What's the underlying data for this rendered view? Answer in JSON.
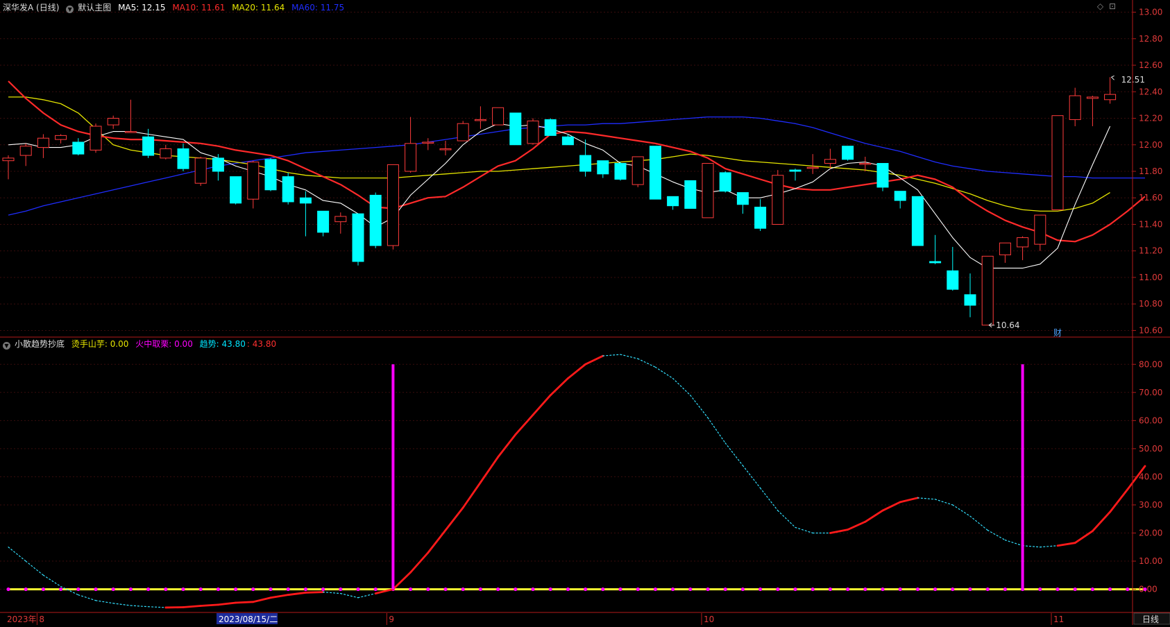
{
  "header": {
    "stock": "深华发A (日线)",
    "template": "默认主图",
    "ma5": "MA5: 12.15",
    "ma10": "MA10: 11.61",
    "ma20": "MA20: 11.64",
    "ma60": "MA60: 11.75"
  },
  "sub_header": {
    "name": "小散趋势抄底",
    "s1": "烫手山芋: 0.00",
    "s2": "火中取栗: 0.00",
    "s3": "趋势: 43.80",
    "s4": ": 43.80"
  },
  "bottom": {
    "year": "2023年",
    "months": [
      "8",
      "9",
      "10",
      "11"
    ],
    "cursor_date": "2023/08/15/二",
    "period": "日线"
  },
  "annotations": {
    "high": "12.51",
    "low": "10.64",
    "fin": "财"
  },
  "colors": {
    "up": "#ff3b3b",
    "down": "#00ffff",
    "ma5": "#ffffff",
    "ma10": "#ff2a2a",
    "ma20": "#e6e600",
    "ma60": "#1f2dff",
    "axis": "#b31a1a",
    "text": "#e03a3a",
    "magenta": "#ff00ff"
  },
  "chart_data": [
    {
      "type": "candlestick",
      "ylim": [
        10.55,
        13.05
      ],
      "yticks": [
        "13.00",
        "12.80",
        "12.60",
        "12.40",
        "12.20",
        "12.00",
        "11.80",
        "11.60",
        "11.40",
        "11.20",
        "11.00",
        "10.80",
        "10.60"
      ],
      "ohlc": [
        [
          11.88,
          11.92,
          11.74,
          11.9
        ],
        [
          11.92,
          12.01,
          11.84,
          11.99
        ],
        [
          11.98,
          12.08,
          11.9,
          12.05
        ],
        [
          12.04,
          12.08,
          12.01,
          12.07
        ],
        [
          12.02,
          12.05,
          11.92,
          11.93
        ],
        [
          11.96,
          12.16,
          11.94,
          12.14
        ],
        [
          12.15,
          12.22,
          12.12,
          12.2
        ],
        [
          12.1,
          12.34,
          12.09,
          12.1
        ],
        [
          12.06,
          12.12,
          11.9,
          11.92
        ],
        [
          11.9,
          12.0,
          11.89,
          11.97
        ],
        [
          11.97,
          12.01,
          11.8,
          11.82
        ],
        [
          11.71,
          11.91,
          11.69,
          11.9
        ],
        [
          11.9,
          11.93,
          11.73,
          11.8
        ],
        [
          11.76,
          11.76,
          11.55,
          11.56
        ],
        [
          11.59,
          11.88,
          11.52,
          11.87
        ],
        [
          11.89,
          11.9,
          11.65,
          11.66
        ],
        [
          11.76,
          11.79,
          11.55,
          11.57
        ],
        [
          11.6,
          11.65,
          11.31,
          11.56
        ],
        [
          11.5,
          11.5,
          11.31,
          11.34
        ],
        [
          11.42,
          11.49,
          11.33,
          11.46
        ],
        [
          11.48,
          11.48,
          11.09,
          11.12
        ],
        [
          11.62,
          11.64,
          11.22,
          11.24
        ],
        [
          11.24,
          11.85,
          11.21,
          11.85
        ],
        [
          11.8,
          12.21,
          11.79,
          12.01
        ],
        [
          12.02,
          12.05,
          11.96,
          12.02
        ],
        [
          11.97,
          12.03,
          11.92,
          11.97
        ],
        [
          12.03,
          12.18,
          12.03,
          12.16
        ],
        [
          12.19,
          12.29,
          12.12,
          12.19
        ],
        [
          12.15,
          12.28,
          12.15,
          12.28
        ],
        [
          12.24,
          12.24,
          12.0,
          12.0
        ],
        [
          12.01,
          12.2,
          12.0,
          12.18
        ],
        [
          12.19,
          12.2,
          12.07,
          12.07
        ],
        [
          12.06,
          12.08,
          12.0,
          12.0
        ],
        [
          11.92,
          12.04,
          11.76,
          11.8
        ],
        [
          11.88,
          11.88,
          11.75,
          11.78
        ],
        [
          11.86,
          11.87,
          11.73,
          11.74
        ],
        [
          11.7,
          11.91,
          11.68,
          11.91
        ],
        [
          11.99,
          11.99,
          11.59,
          11.59
        ],
        [
          11.61,
          11.61,
          11.51,
          11.54
        ],
        [
          11.73,
          11.73,
          11.55,
          11.52
        ],
        [
          11.45,
          11.86,
          11.45,
          11.86
        ],
        [
          11.79,
          11.8,
          11.64,
          11.65
        ],
        [
          11.64,
          11.64,
          11.48,
          11.55
        ],
        [
          11.53,
          11.59,
          11.35,
          11.37
        ],
        [
          11.4,
          11.81,
          11.4,
          11.77
        ],
        [
          11.81,
          11.82,
          11.73,
          11.8
        ],
        [
          11.83,
          11.93,
          11.78,
          11.83
        ],
        [
          11.86,
          11.97,
          11.82,
          11.89
        ],
        [
          11.99,
          11.99,
          11.88,
          11.89
        ],
        [
          11.86,
          11.91,
          11.8,
          11.86
        ],
        [
          11.86,
          11.86,
          11.65,
          11.68
        ],
        [
          11.65,
          11.65,
          11.52,
          11.58
        ],
        [
          11.61,
          11.61,
          11.24,
          11.24
        ],
        [
          11.12,
          11.32,
          11.1,
          11.11
        ],
        [
          11.05,
          11.23,
          10.9,
          10.91
        ],
        [
          10.87,
          11.03,
          10.7,
          10.79
        ],
        [
          10.64,
          11.16,
          10.64,
          11.16
        ],
        [
          11.17,
          11.26,
          11.11,
          11.26
        ],
        [
          11.23,
          11.31,
          11.13,
          11.3
        ],
        [
          11.25,
          11.47,
          11.2,
          11.47
        ],
        [
          11.51,
          12.22,
          11.51,
          12.22
        ],
        [
          12.19,
          12.43,
          12.14,
          12.37
        ],
        [
          12.35,
          12.37,
          12.14,
          12.36
        ],
        [
          12.34,
          12.51,
          12.31,
          12.38
        ]
      ],
      "ma5": [
        12.0,
        12.01,
        11.98,
        11.98,
        12.0,
        12.06,
        12.1,
        12.1,
        12.08,
        12.06,
        12.04,
        11.94,
        11.9,
        11.84,
        11.8,
        11.76,
        11.7,
        11.66,
        11.58,
        11.56,
        11.48,
        11.38,
        11.45,
        11.62,
        11.74,
        11.86,
        12.0,
        12.1,
        12.16,
        12.14,
        12.15,
        12.12,
        12.08,
        12.01,
        11.96,
        11.86,
        11.84,
        11.78,
        11.72,
        11.67,
        11.64,
        11.66,
        11.6,
        11.6,
        11.63,
        11.67,
        11.72,
        11.82,
        11.86,
        11.87,
        11.84,
        11.75,
        11.66,
        11.48,
        11.3,
        11.15,
        11.07,
        11.07,
        11.07,
        11.1,
        11.22,
        11.55,
        11.85,
        12.14
      ],
      "ma10": [
        12.48,
        12.35,
        12.24,
        12.15,
        12.1,
        12.07,
        12.05,
        12.04,
        12.04,
        12.03,
        12.02,
        12.01,
        11.99,
        11.96,
        11.94,
        11.92,
        11.88,
        11.82,
        11.76,
        11.7,
        11.62,
        11.53,
        11.52,
        11.56,
        11.6,
        11.61,
        11.68,
        11.76,
        11.84,
        11.88,
        11.97,
        12.08,
        12.1,
        12.09,
        12.07,
        12.05,
        12.03,
        12.01,
        11.98,
        11.95,
        11.9,
        11.82,
        11.78,
        11.74,
        11.7,
        11.67,
        11.66,
        11.66,
        11.68,
        11.7,
        11.72,
        11.74,
        11.77,
        11.74,
        11.68,
        11.58,
        11.5,
        11.43,
        11.38,
        11.34,
        11.28,
        11.27,
        11.32,
        11.4,
        11.5,
        11.61
      ],
      "ma20": [
        12.36,
        12.36,
        12.34,
        12.31,
        12.24,
        12.12,
        12.0,
        11.96,
        11.94,
        11.92,
        11.91,
        11.9,
        11.89,
        11.87,
        11.85,
        11.82,
        11.79,
        11.77,
        11.76,
        11.75,
        11.75,
        11.75,
        11.75,
        11.76,
        11.77,
        11.78,
        11.79,
        11.8,
        11.8,
        11.81,
        11.82,
        11.83,
        11.84,
        11.85,
        11.86,
        11.87,
        11.88,
        11.89,
        11.91,
        11.93,
        11.92,
        11.9,
        11.88,
        11.87,
        11.86,
        11.85,
        11.84,
        11.83,
        11.82,
        11.81,
        11.79,
        11.77,
        11.74,
        11.71,
        11.67,
        11.63,
        11.58,
        11.54,
        11.51,
        11.5,
        11.5,
        11.52,
        11.56,
        11.64
      ],
      "ma60": [
        11.47,
        11.5,
        11.54,
        11.57,
        11.6,
        11.63,
        11.66,
        11.69,
        11.72,
        11.75,
        11.78,
        11.81,
        11.84,
        11.86,
        11.88,
        11.9,
        11.92,
        11.94,
        11.95,
        11.96,
        11.97,
        11.98,
        11.99,
        12.0,
        12.02,
        12.04,
        12.06,
        12.08,
        12.1,
        12.12,
        12.13,
        12.14,
        12.15,
        12.15,
        12.16,
        12.16,
        12.17,
        12.18,
        12.19,
        12.2,
        12.21,
        12.21,
        12.21,
        12.2,
        12.18,
        12.16,
        12.13,
        12.09,
        12.05,
        12.01,
        11.98,
        11.95,
        11.91,
        11.87,
        11.84,
        11.82,
        11.8,
        11.79,
        11.78,
        11.77,
        11.76,
        11.76,
        11.75,
        11.75,
        11.75,
        11.75
      ]
    },
    {
      "type": "line",
      "ylim": [
        -8,
        85
      ],
      "yticks": [
        "80.00",
        "70.00",
        "60.00",
        "50.00",
        "40.00",
        "30.00",
        "20.00",
        "10.00",
        "0.00"
      ],
      "trend": [
        15,
        10,
        5,
        1,
        -2,
        -4,
        -5,
        -5.8,
        -6.2,
        -6.5,
        -6.4,
        -5.9,
        -5.5,
        -4.8,
        -4.5,
        -3,
        -2,
        -1.2,
        -1.0,
        -1.5,
        -3,
        -1.5,
        0,
        6,
        13,
        21,
        29,
        38,
        47,
        55,
        62,
        69,
        75,
        80,
        83,
        83.5,
        82,
        79,
        75,
        69,
        61,
        52,
        44,
        36,
        28,
        22,
        20,
        20,
        21.2,
        24,
        28,
        31,
        32.5,
        32,
        30,
        26,
        21,
        17.5,
        15.5,
        15,
        15.5,
        16.5,
        20.7,
        27.5,
        35.5,
        43.8
      ],
      "trend_rising": [
        false,
        false,
        false,
        false,
        false,
        false,
        false,
        false,
        false,
        false,
        true,
        true,
        true,
        true,
        true,
        true,
        true,
        true,
        true,
        false,
        false,
        false,
        true,
        true,
        true,
        true,
        true,
        true,
        true,
        true,
        true,
        true,
        true,
        true,
        true,
        false,
        false,
        false,
        false,
        false,
        false,
        false,
        false,
        false,
        false,
        false,
        false,
        false,
        true,
        true,
        true,
        true,
        true,
        false,
        false,
        false,
        false,
        false,
        false,
        false,
        false,
        true,
        true,
        true,
        true,
        true
      ],
      "signal_bars": [
        {
          "index": 22,
          "value": 80
        },
        {
          "index": 58,
          "value": 80
        }
      ],
      "zero_line": 0
    }
  ]
}
